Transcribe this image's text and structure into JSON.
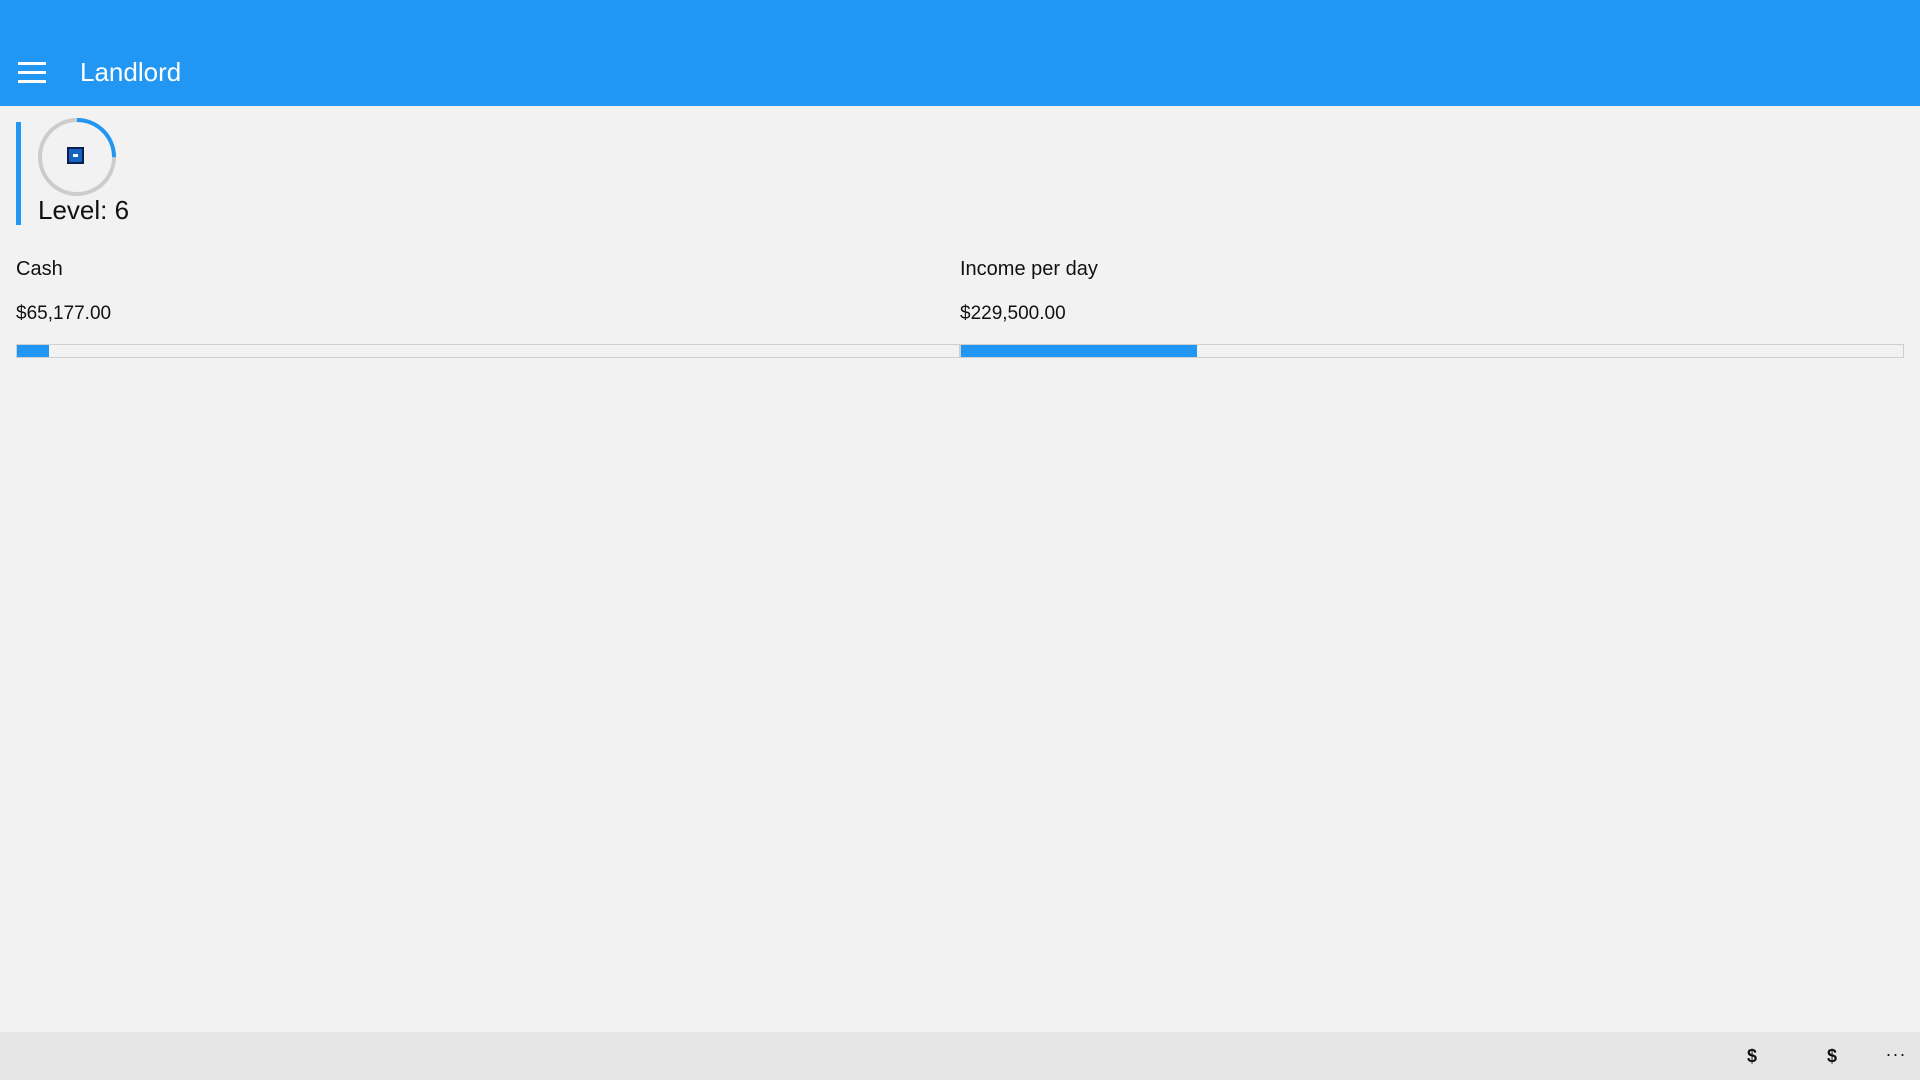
{
  "header": {
    "title": "Landlord",
    "menu_icon": "hamburger-menu-icon",
    "background_color": "#2196f3"
  },
  "level": {
    "label": "Level:",
    "value": "6",
    "progress_fraction": 0.25,
    "icon": "level-up-icon",
    "accent_color": "#2196f3"
  },
  "stats": {
    "cash": {
      "label": "Cash",
      "value": "$65,177.00",
      "progress_fraction": 0.034
    },
    "income": {
      "label": "Income per day",
      "value": "$229,500.00",
      "progress_fraction": 0.25
    }
  },
  "bottom_bar": {
    "buttons": [
      {
        "label": "$",
        "icon": "dollar-icon"
      },
      {
        "label": "$",
        "icon": "dollar-icon"
      }
    ],
    "more_label": "···"
  }
}
